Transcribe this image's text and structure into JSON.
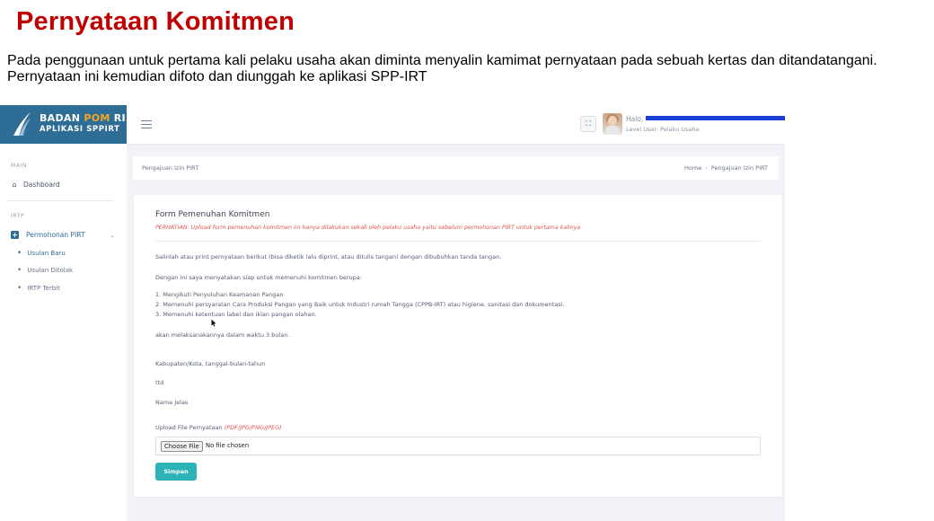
{
  "slide": {
    "title": "Pernyataan Komitmen",
    "description": "Pada penggunaan untuk pertama kali pelaku usaha akan diminta menyalin kamimat pernyataan pada sebuah kertas dan ditandatangani. Pernyataan ini kemudian difoto dan diunggah ke aplikasi SPP-IRT"
  },
  "app": {
    "logo_line1_a": "BADAN ",
    "logo_line1_b": "POM",
    "logo_line1_c": " RI",
    "logo_line2": "APLIKASI SPPIRT",
    "brand_color": "#2e6d96"
  },
  "topbar": {
    "fullscreen_icon": "fullscreen-icon",
    "greeting": "Halo,",
    "level": "Level User: Pelaku Usaha"
  },
  "sidebar": {
    "main_heading": "MAIN",
    "dashboard": "Dashboard",
    "irtp_heading": "IRTP",
    "parent": "Permohonan PIRT",
    "sub_items": [
      "Usulan Baru",
      "Usulan Ditolak",
      "IRTP Terbit"
    ]
  },
  "breadcrumb": {
    "page": "Pengajuan Izin PIRT",
    "home": "Home",
    "separator": "›",
    "current": "Pengajuan Izin PIRT"
  },
  "form": {
    "title": "Form Pemenuhan Komitmen",
    "warning": "PERHATIAN: Upload form pemenuhan komitmen ini hanya dilakukan sekali oleh pelaku usaha yaitu sebelum permohonan PIRT untuk pertama kalinya",
    "instruction": "Salinlah atau print pernyataan berikut (bisa diketik lalu diprint, atau ditulis tangan) dengan dibubuhkan tanda tangan.",
    "intro": "Dengan ini saya menyatakan siap untuk memenuhi komitmen berupa:",
    "items": [
      "1. Mengikuti Penyuluhan Keamanan Pangan",
      "2. Memenuhi persyaratan Cara Produksi Pangan yang Baik untuk Industri rumah Tangga (CPPB-IRT) atau higiene, sanitasi dan dokumentasi.",
      "3. Memenuhi ketentuan label dan iklan pangan olahan."
    ],
    "deadline": "akan melaksanakannya dalam waktu 3 bulan.",
    "place_date": "Kabupaten/Kota, tanggal-bulan-tahun",
    "ttd": "ttd",
    "name": "Nama Jelas",
    "upload_label": "Upload File Pernyataan",
    "upload_formats": "(PDF/JPG/PNG/JPEG)",
    "choose_file": "Choose File",
    "no_file": "No file chosen",
    "save": "Simpan"
  }
}
